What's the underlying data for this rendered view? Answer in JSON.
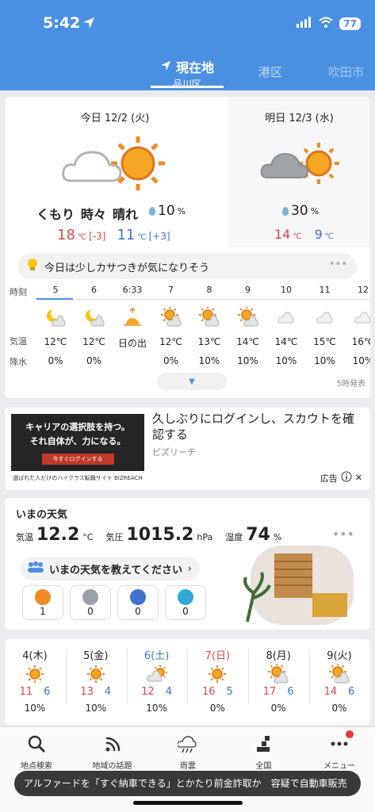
{
  "status": {
    "time": "5:42",
    "battery": "77"
  },
  "tabs": [
    {
      "label": "現在地",
      "sub": "品川区"
    },
    {
      "label": "港区"
    },
    {
      "label": "吹田市"
    }
  ],
  "today": {
    "title": "今日 12/2 (火)",
    "condition": [
      "くもり",
      "時々",
      "晴れ"
    ],
    "pop": "10",
    "pop_unit": "%",
    "high": "18",
    "high_diff": "[-3]",
    "low": "11",
    "low_diff": "[+3]",
    "unit": "℃"
  },
  "tomorrow": {
    "title": "明日 12/3 (水)",
    "pop": "30",
    "pop_unit": "%",
    "high": "14",
    "low": "9",
    "unit": "℃"
  },
  "advice": "今日は少しカサつきが気になりそう",
  "hourly": {
    "labels": {
      "hour": "時刻",
      "temp": "気温",
      "precip": "降水"
    },
    "cols": [
      {
        "h": "5",
        "icon": "moon-cloud-icon",
        "t": "12℃",
        "p": "0%"
      },
      {
        "h": "6",
        "icon": "moon-cloud-icon",
        "t": "12℃",
        "p": "0%"
      },
      {
        "h": "6:33",
        "icon": "sunrise-icon",
        "t": "日の出",
        "p": ""
      },
      {
        "h": "7",
        "icon": "sun-cloud-icon",
        "t": "12℃",
        "p": "0%"
      },
      {
        "h": "8",
        "icon": "sun-cloud-icon",
        "t": "13℃",
        "p": "10%"
      },
      {
        "h": "9",
        "icon": "sun-cloud-icon",
        "t": "14℃",
        "p": "10%"
      },
      {
        "h": "10",
        "icon": "cloud-icon",
        "t": "14℃",
        "p": "10%"
      },
      {
        "h": "11",
        "icon": "cloud-icon",
        "t": "15℃",
        "p": "10%"
      },
      {
        "h": "12",
        "icon": "cloud-icon",
        "t": "16℃",
        "p": "10%"
      }
    ],
    "issued": "5時発表"
  },
  "ad": {
    "img_line1": "キャリアの選択肢を持つ。",
    "img_line2": "それ自体が、力になる。",
    "img_button": "今すぐログインする",
    "img_footer": "選ばれた人だけのハイクラス転職サイト BIZREACH",
    "title": "久しぶりにログインし、スカウトを確認する",
    "source": "ビズリーチ",
    "label": "広告"
  },
  "now": {
    "title": "いまの天気",
    "temp_label": "気温",
    "temp": "12.2",
    "temp_unit": "°C",
    "pressure_label": "気圧",
    "pressure": "1015.2",
    "pressure_unit": "hPa",
    "humidity_label": "湿度",
    "humidity": "74",
    "humidity_unit": "%",
    "tell": "いまの天気を教えてください",
    "reports": [
      {
        "icon": "sun-report-icon",
        "count": "1",
        "color": "#f08a24"
      },
      {
        "icon": "cloud-report-icon",
        "count": "0",
        "color": "#9aa0a8"
      },
      {
        "icon": "rain-report-icon",
        "count": "0",
        "color": "#3f73cf"
      },
      {
        "icon": "snow-report-icon",
        "count": "0",
        "color": "#2fa8d8"
      }
    ]
  },
  "weekly": [
    {
      "d": "4(木)",
      "icon": "sun-icon",
      "hi": "11",
      "lo": "6",
      "p": "10%"
    },
    {
      "d": "5(金)",
      "icon": "sun-icon",
      "hi": "13",
      "lo": "4",
      "p": "10%"
    },
    {
      "d": "6(土)",
      "icon": "cloud-sun-icon",
      "hi": "12",
      "lo": "4",
      "p": "10%"
    },
    {
      "d": "7(日)",
      "icon": "sun-icon",
      "hi": "16",
      "lo": "5",
      "p": "0%"
    },
    {
      "d": "8(月)",
      "icon": "sun-cloud-icon",
      "hi": "17",
      "lo": "6",
      "p": "0%"
    },
    {
      "d": "9(火)",
      "icon": "sun-cloud-icon",
      "hi": "14",
      "lo": "6",
      "p": "0%"
    }
  ],
  "nav": [
    {
      "label": "地点検索",
      "icon": "search-icon"
    },
    {
      "label": "地域の話題",
      "icon": "broadcast-icon"
    },
    {
      "label": "雨雲",
      "icon": "rain-cloud-icon"
    },
    {
      "label": "全国",
      "icon": "map-icon"
    },
    {
      "label": "メニュー",
      "icon": "more-icon"
    }
  ],
  "ticker": "アルファードを「すぐ納車できる」とかたり前金詐取か　容疑で自動車販売"
}
